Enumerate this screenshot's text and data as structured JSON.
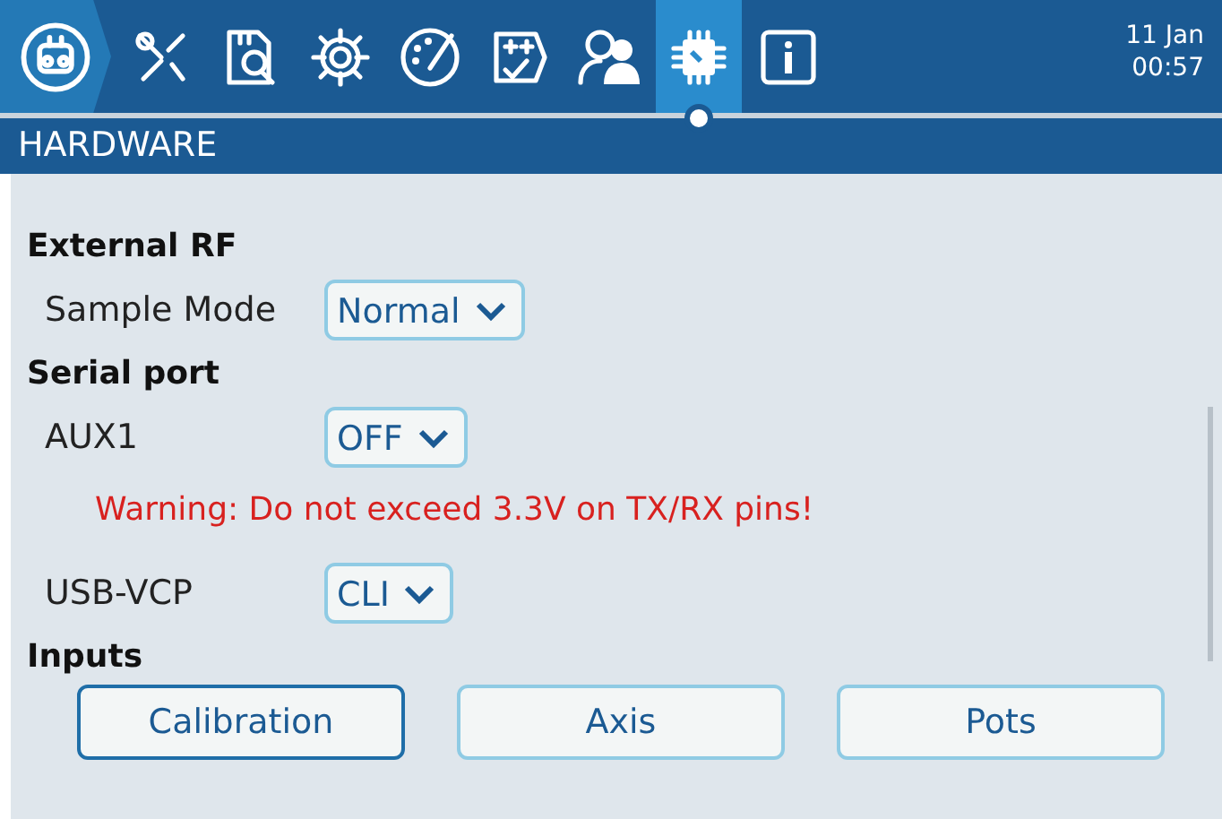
{
  "tabs": [
    {
      "selected": false
    },
    {
      "selected": false
    },
    {
      "selected": false
    },
    {
      "selected": false
    },
    {
      "selected": false
    },
    {
      "selected": false
    },
    {
      "selected": false
    },
    {
      "selected": true
    },
    {
      "selected": false
    }
  ],
  "date": "11 Jan",
  "time": "00:57",
  "title": "HARDWARE",
  "items": [
    {
      "kind": "heading",
      "text": "External RF"
    },
    {
      "kind": "row",
      "cells": [
        {
          "label": "Sample Mode",
          "value": "Normal",
          "dropdown": true
        }
      ]
    },
    {
      "kind": "heading",
      "text": "Serial port"
    },
    {
      "kind": "row",
      "cells": [
        {
          "label": "AUX1",
          "value": "OFF",
          "dropdown": true
        }
      ]
    },
    {
      "kind": "warning",
      "text": "Warning: Do not exceed 3.3V on TX/RX pins!"
    },
    {
      "kind": "row",
      "cells": [
        {
          "label": "USB-VCP",
          "value": "CLI",
          "dropdown": true
        }
      ]
    },
    {
      "kind": "heading",
      "text": "Inputs"
    },
    {
      "kind": "buttons",
      "buttons": [
        {
          "label": "Calibration",
          "focused": true
        },
        {
          "label": "Axis",
          "focused": false
        },
        {
          "label": "Pots",
          "focused": false
        }
      ]
    }
  ]
}
